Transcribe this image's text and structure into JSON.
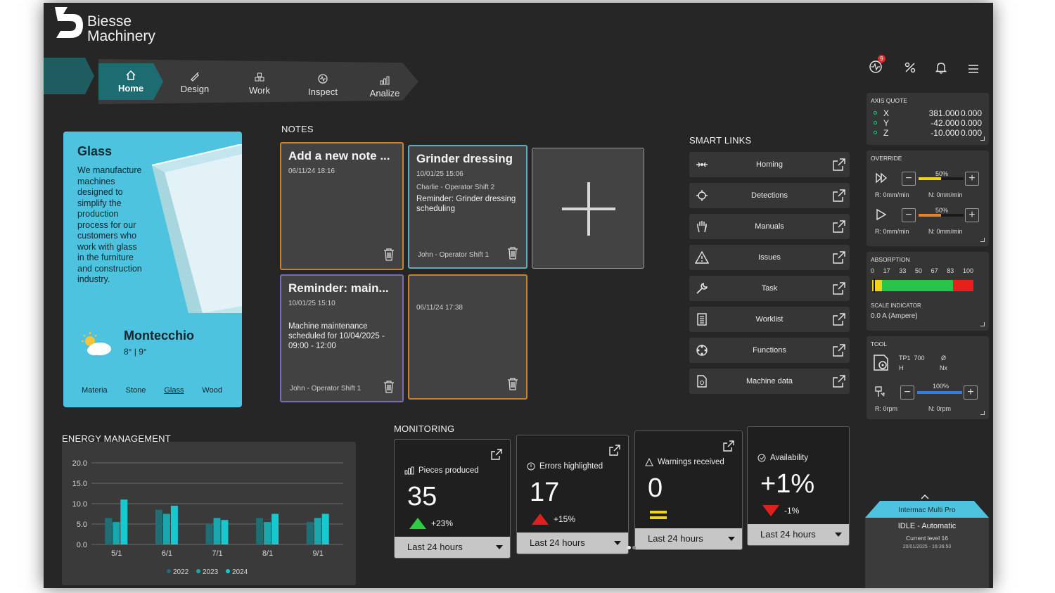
{
  "brand": {
    "line1": "Biesse",
    "line2": "Machinery"
  },
  "nav": {
    "items": [
      {
        "label": "Home",
        "icon": "home-icon",
        "active": true
      },
      {
        "label": "Design",
        "icon": "design-icon",
        "active": false
      },
      {
        "label": "Work",
        "icon": "work-icon",
        "active": false
      },
      {
        "label": "Inspect",
        "icon": "inspect-icon",
        "active": false
      },
      {
        "label": "Analize",
        "icon": "analize-icon",
        "active": false
      }
    ]
  },
  "topbar": {
    "alerts_count": "9",
    "icons": [
      "activity-icon",
      "percent-icon",
      "bell-icon",
      "hamburger-menu-icon"
    ]
  },
  "glass_card": {
    "title": "Glass",
    "description": "We manufacture machines designed to simplify the production process for our customers who work with glass in the furniture and construction industry.",
    "city": "Montecchio",
    "temps": "8° | 9°",
    "weather_icon": "partly-sunny-icon",
    "materials": [
      "Materia",
      "Stone",
      "Glass",
      "Wood"
    ],
    "selected_material": "Glass"
  },
  "notes": {
    "title": "NOTES",
    "items": [
      {
        "title": "Add a new note ...",
        "date": "06/11/24 18:16",
        "author_top": "",
        "body": "",
        "footer": ""
      },
      {
        "title": "Grinder dressing",
        "date": "10/01/25 15:06",
        "author_top": "Charlie - Operator Shift 2",
        "body": "Reminder: Grinder dressing scheduling",
        "footer": "John - Operator Shift 1"
      },
      {
        "title": "Reminder: main...",
        "date": "10/01/25 15:10",
        "author_top": "",
        "body": "Machine maintenance scheduled for 10/04/2025 - 09:00 - 12:00",
        "footer": "John - Operator Shift 1"
      },
      {
        "title": "",
        "date": "06/11/24 17:38",
        "author_top": "",
        "body": "",
        "footer": ""
      }
    ]
  },
  "smart_links": {
    "title": "SMART LINKS",
    "items": [
      {
        "label": "Homing",
        "icon": "homing-icon"
      },
      {
        "label": "Detections",
        "icon": "detections-icon"
      },
      {
        "label": "Manuals",
        "icon": "hand-icon"
      },
      {
        "label": "Issues",
        "icon": "warning-icon"
      },
      {
        "label": "Task",
        "icon": "wrench-icon"
      },
      {
        "label": "Worklist",
        "icon": "worklist-icon"
      },
      {
        "label": "Functions",
        "icon": "functions-icon"
      },
      {
        "label": "Machine data",
        "icon": "machine-data-icon"
      }
    ]
  },
  "axis_quote": {
    "title": "AXIS QUOTE",
    "rows": [
      {
        "axis": "X",
        "value": "381.000",
        "offset": "0.000"
      },
      {
        "axis": "Y",
        "value": "-42.000",
        "offset": "0.000"
      },
      {
        "axis": "Z",
        "value": "-10.000",
        "offset": "0.000"
      }
    ]
  },
  "override": {
    "title": "OVERRIDE",
    "rows": [
      {
        "icon": "fast-forward-icon",
        "percent_label": "50%",
        "level": 0.5,
        "r": "R: 0mm/min",
        "n": "N: 0mm/min"
      },
      {
        "icon": "play-icon",
        "percent_label": "50%",
        "level": 0.5,
        "r": "R: 0mm/min",
        "n": "N: 0mm/min"
      }
    ]
  },
  "absorption": {
    "title": "ABSORPTION",
    "scale": [
      "0",
      "17",
      "33",
      "50",
      "67",
      "83",
      "100"
    ],
    "scale_label": "SCALE INDICATOR",
    "value": "0.0 A (Ampere)"
  },
  "tool": {
    "title": "TOOL",
    "name": "TP1",
    "h_label": "H",
    "h_value": "700",
    "d_label": "Ø",
    "nx_label": "Nx",
    "percent_label": "100%",
    "level": 1.0,
    "r": "R: 0rpm",
    "n": "N: 0rpm"
  },
  "energy": {
    "title": "ENERGY MANAGEMENT"
  },
  "chart_data": {
    "type": "bar",
    "categories": [
      "5/1",
      "6/1",
      "7/1",
      "8/1",
      "9/1"
    ],
    "series": [
      {
        "name": "2022",
        "values": [
          6.5,
          8.5,
          5.0,
          6.5,
          5.5
        ]
      },
      {
        "name": "2023",
        "values": [
          5.5,
          7.5,
          6.5,
          5.5,
          6.5
        ]
      },
      {
        "name": "2024",
        "values": [
          11.0,
          9.5,
          6.0,
          7.5,
          7.5
        ]
      }
    ],
    "yticks": [
      "20.0",
      "15.0",
      "10.0",
      "5.0",
      "0.0"
    ],
    "ylim": [
      0,
      20
    ],
    "colors": [
      "#1f6e73",
      "#19a7ad",
      "#17c9cf"
    ],
    "legend": "bottom",
    "grid": true
  },
  "monitoring": {
    "title": "MONITORING",
    "cards": [
      {
        "label": "Pieces produced",
        "icon": "pieces-icon",
        "value": "35",
        "trend": "+23%",
        "trend_dir": "up",
        "period": "Last 24 hours"
      },
      {
        "label": "Errors highlighted",
        "icon": "error-info-icon",
        "value": "17",
        "trend": "+15%",
        "trend_dir": "up-red",
        "period": "Last 24 hours"
      },
      {
        "label": "Warnings received",
        "icon": "warning-small-icon",
        "value": "0",
        "trend": "",
        "trend_dir": "equal",
        "period": "Last 24 hours"
      },
      {
        "label": "Availability",
        "icon": "availability-icon",
        "value": "+1%",
        "trend": "-1%",
        "trend_dir": "down",
        "period": "Last 24 hours"
      }
    ]
  },
  "machine_status": {
    "name": "Intermac Multi Pro",
    "state": "IDLE - Automatic",
    "level": "Current level 16",
    "timestamp": "20/01/2025 - 16:36:50"
  },
  "colors": {
    "accent": "#1d6c72",
    "glass_card": "#4ec3e0",
    "note_orange": "#c8822f",
    "note_blue": "#63a9c4",
    "note_purple": "#7d6bb8",
    "trend_up": "#2ecc40",
    "trend_down": "#e02020"
  }
}
